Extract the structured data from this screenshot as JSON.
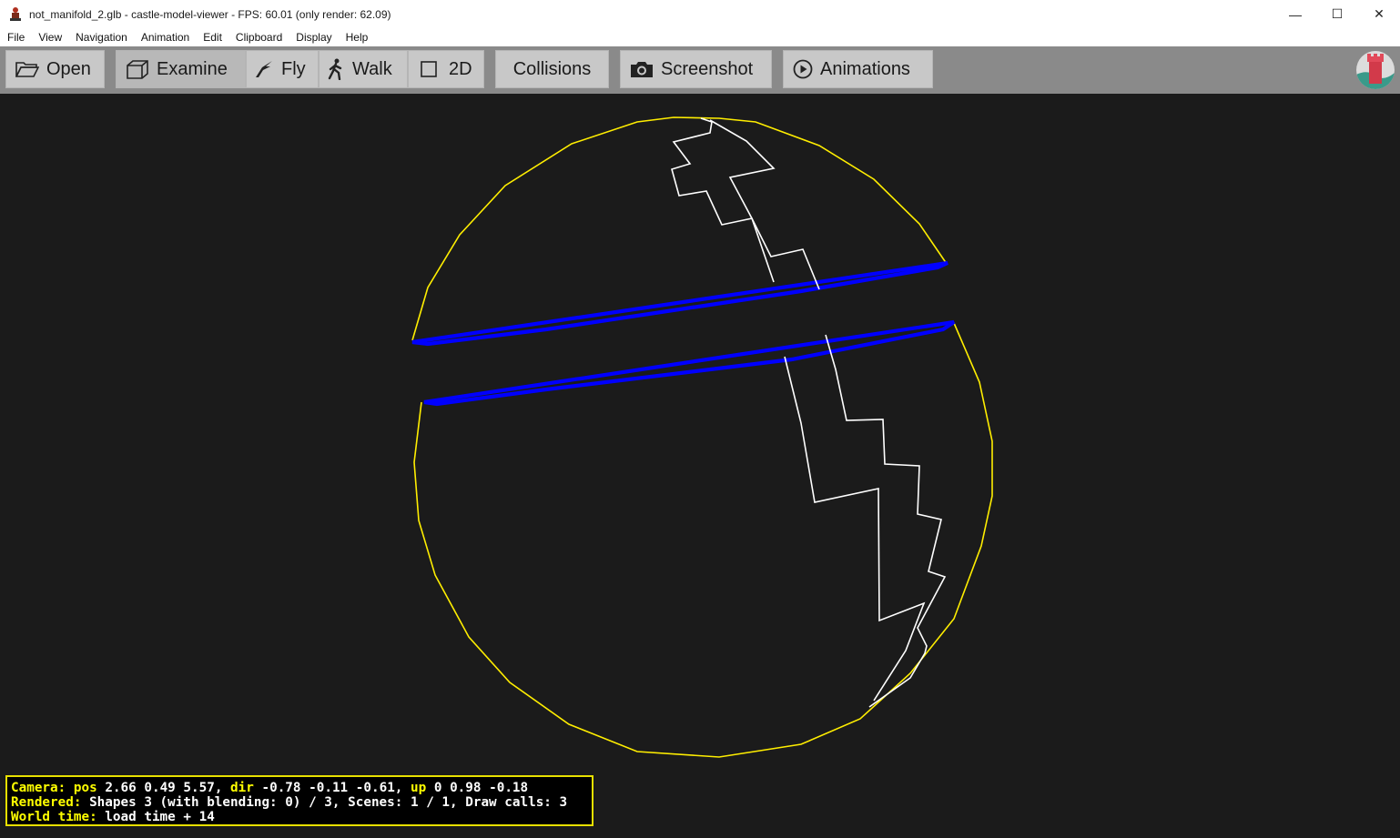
{
  "window": {
    "title": "not_manifold_2.glb - castle-model-viewer - FPS: 60.01 (only render: 62.09)",
    "minimize_glyph": "—",
    "maximize_glyph": "☐",
    "close_glyph": "✕"
  },
  "menu": [
    "File",
    "View",
    "Navigation",
    "Animation",
    "Edit",
    "Clipboard",
    "Display",
    "Help"
  ],
  "toolbar": {
    "open": "Open",
    "examine": "Examine",
    "fly": "Fly",
    "walk": "Walk",
    "two_d": "2D",
    "collisions": "Collisions",
    "screenshot": "Screenshot",
    "animations": "Animations"
  },
  "icons": {
    "open": "folder-icon",
    "examine": "cube-icon",
    "fly": "bird-icon",
    "walk": "walking-person-icon",
    "two_d": "square-icon",
    "screenshot": "camera-icon",
    "animations": "play-circle-icon",
    "logo": "castle-logo-icon"
  },
  "colors": {
    "sphere_outline": "#ffee00",
    "rings": "#0000ff",
    "crack": "#ffffff",
    "background": "#1b1b1b"
  },
  "status": {
    "camera_label": "Camera:",
    "pos_label": "pos",
    "pos_value": "2.66 0.49 5.57,",
    "dir_label": "dir",
    "dir_value": "-0.78 -0.11 -0.61,",
    "up_label": "up",
    "up_value": "0 0.98 -0.18",
    "rendered_label": "Rendered:",
    "rendered_value": "Shapes 3 (with blending: 0) / 3, Scenes: 1 / 1, Draw calls: 3",
    "world_time_label": "World time:",
    "world_time_value": "load time + 14"
  }
}
